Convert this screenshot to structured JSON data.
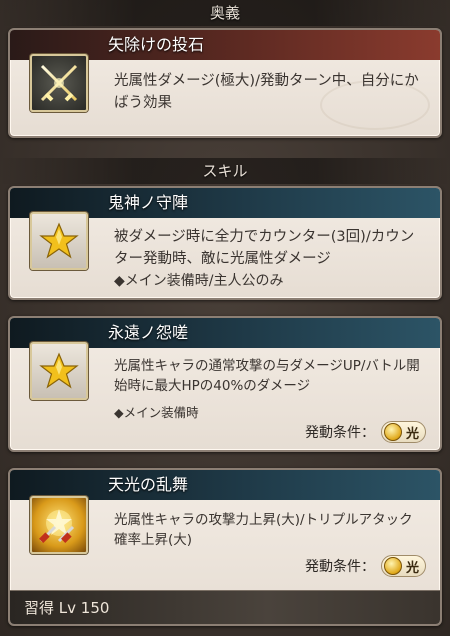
{
  "sections": {
    "ougi_header": "奥義",
    "skill_header": "スキル"
  },
  "ougi": {
    "name": "矢除けの投石",
    "description": "光属性ダメージ(極大)/発動ターン中、自分にかばう効果",
    "icon": "crossed-swords-icon"
  },
  "skills": [
    {
      "name": "鬼神ノ守陣",
      "description": "被ダメージ時に全力でカウンター(3回)/カウンター発動時、敵に光属性ダメージ",
      "note": "◆メイン装備時/主人公のみ",
      "icon": "star-icon"
    },
    {
      "name": "永遠ノ怨嗟",
      "description": "光属性キャラの通常攻撃の与ダメージUP/バトル開始時に最大HPの40%のダメージ",
      "note": "◆メイン装備時",
      "condition_label": "発動条件：",
      "condition_value": "光",
      "icon": "star-icon"
    },
    {
      "name": "天光の乱舞",
      "description": "光属性キャラの攻撃力上昇(大)/トリプルアタック確率上昇(大)",
      "condition_label": "発動条件：",
      "condition_value": "光",
      "acquire": "習得 Lv 150",
      "icon": "light-swords-icon"
    }
  ],
  "colors": {
    "ougi_title_bg": "#8a3b2e",
    "skill_title_bg": "#2c5466",
    "badge_gold": "#e0a81a"
  }
}
